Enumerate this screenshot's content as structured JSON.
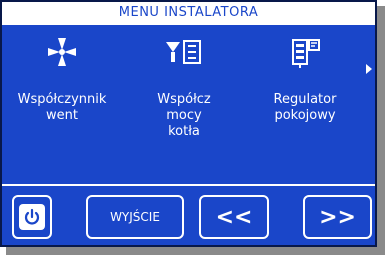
{
  "header": {
    "title": "MENU INSTALATORA"
  },
  "menu": {
    "items": [
      {
        "label": "Współczynnik\nwent",
        "icon": "fan-icon"
      },
      {
        "label": "Współcz\nmocy\nkotła",
        "icon": "boiler-power-icon"
      },
      {
        "label": "Regulator\npokojowy",
        "icon": "room-thermostat-icon"
      }
    ],
    "more_icon": "chevron-right-icon"
  },
  "footer": {
    "power_icon": "power-icon",
    "exit_label": "WYJŚCIE",
    "prev_label": "<<",
    "next_label": ">>"
  },
  "colors": {
    "background": "#1a46c9",
    "foreground": "#ffffff"
  }
}
